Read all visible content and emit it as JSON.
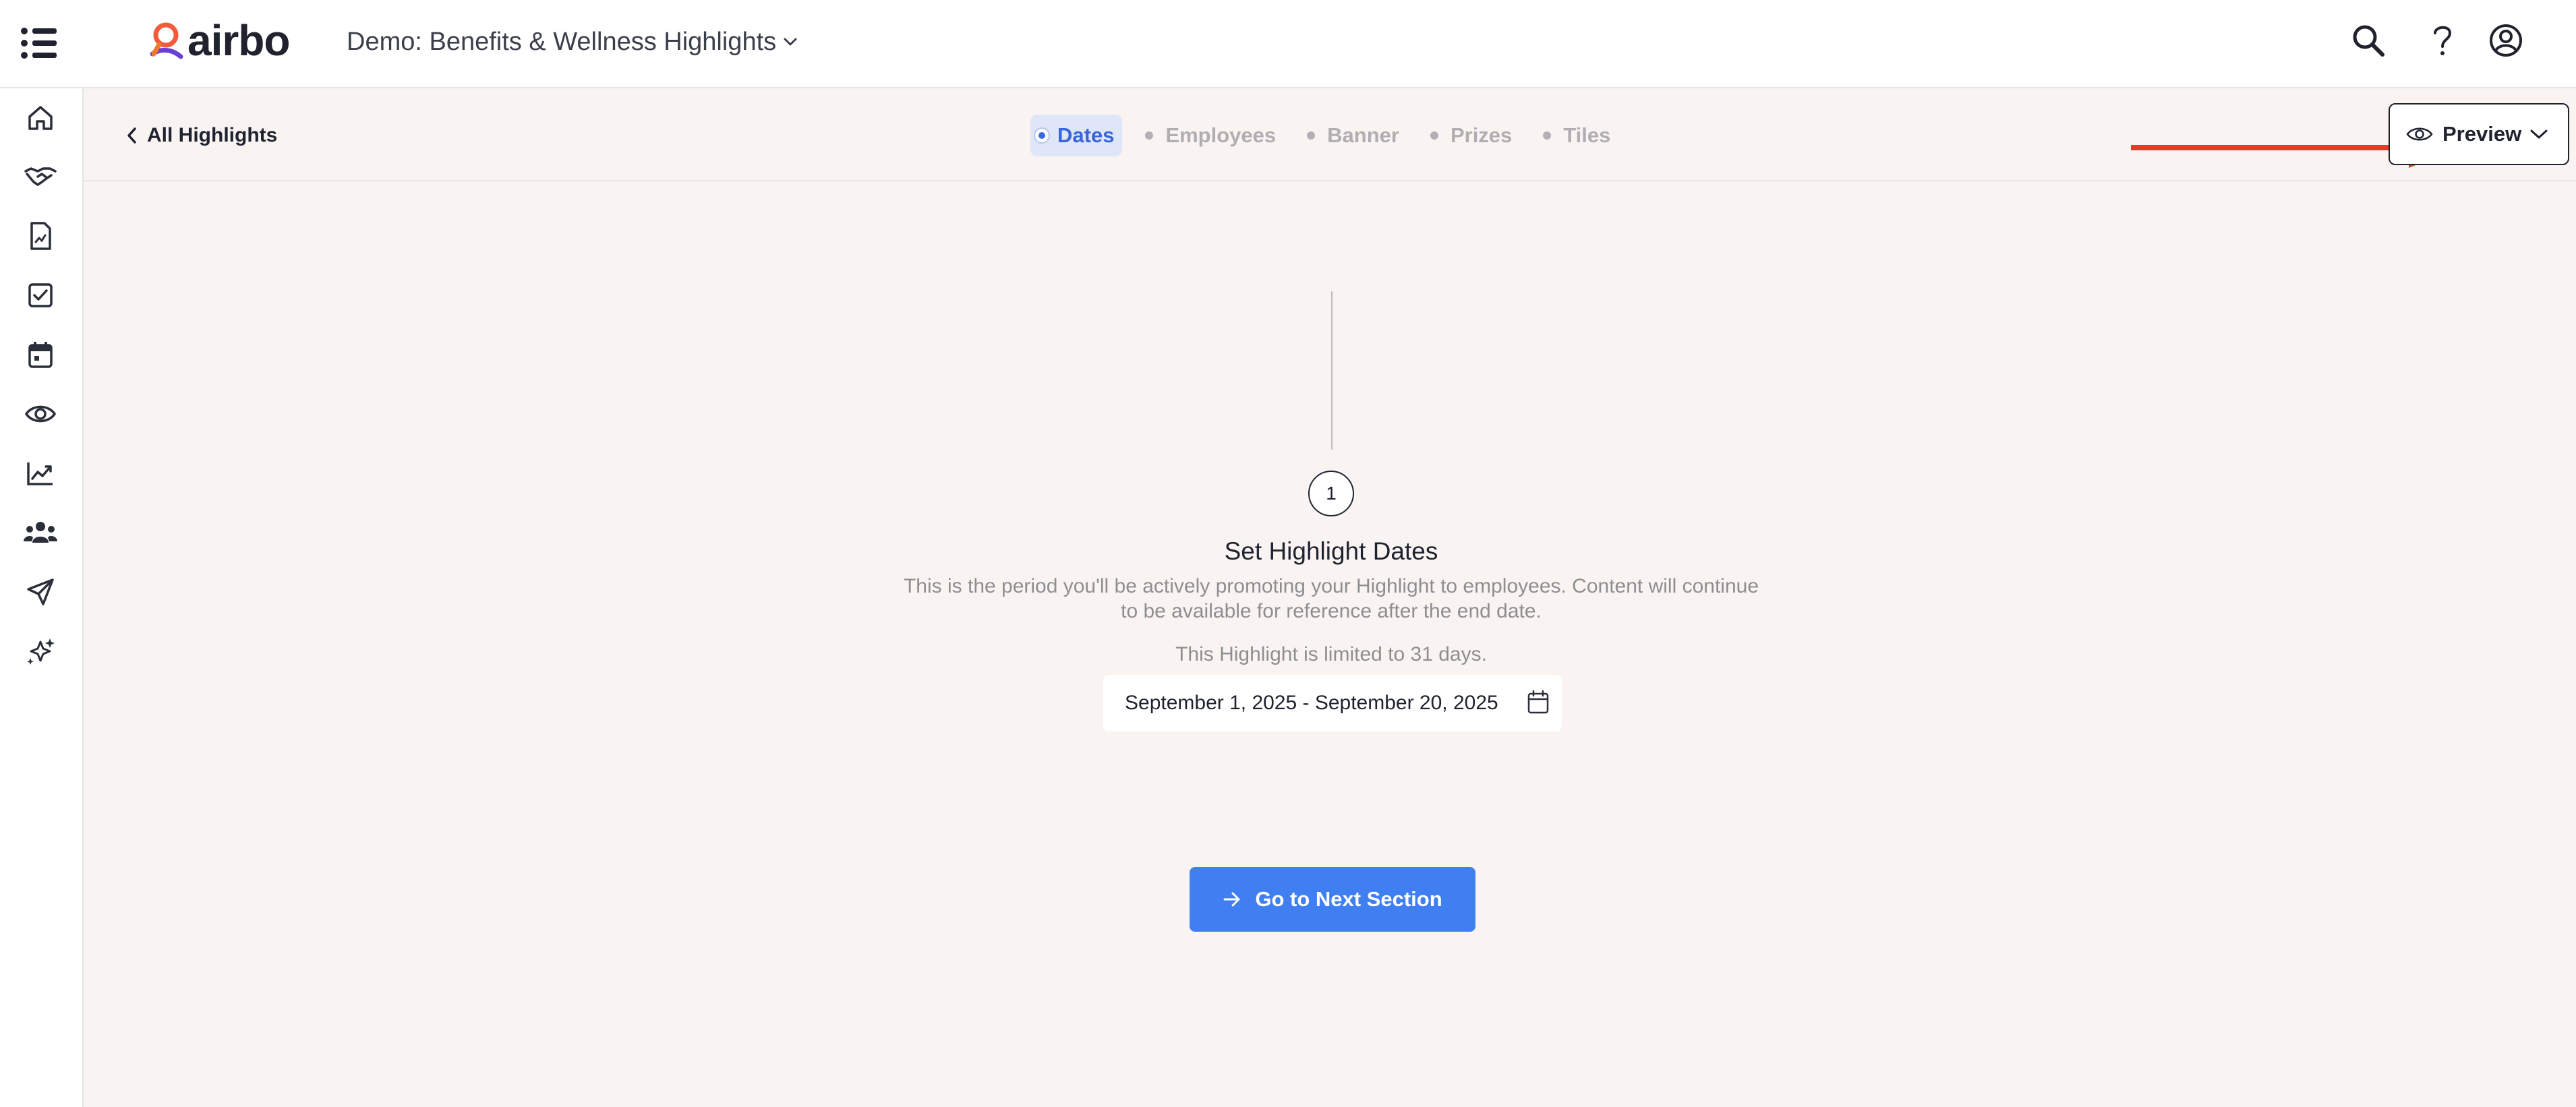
{
  "topbar": {
    "brand": "airbo",
    "workspace": "Demo: Benefits & Wellness Highlights",
    "icons": [
      "search-icon",
      "help-icon",
      "account-icon"
    ]
  },
  "sidebar": {
    "items": [
      {
        "icon": "home-icon"
      },
      {
        "icon": "handshake-icon"
      },
      {
        "icon": "document-icon"
      },
      {
        "icon": "checkbox-icon"
      },
      {
        "icon": "calendar-icon"
      },
      {
        "icon": "eye-icon"
      },
      {
        "icon": "trend-chart-icon"
      },
      {
        "icon": "people-icon"
      },
      {
        "icon": "send-icon"
      },
      {
        "icon": "sparkles-icon"
      }
    ]
  },
  "subnav": {
    "back_label": "All Highlights",
    "steps": [
      {
        "label": "Dates",
        "active": true
      },
      {
        "label": "Employees",
        "active": false
      },
      {
        "label": "Banner",
        "active": false
      },
      {
        "label": "Prizes",
        "active": false
      },
      {
        "label": "Tiles",
        "active": false
      }
    ],
    "preview_label": "Preview"
  },
  "content": {
    "step_number": "1",
    "title": "Set Highlight Dates",
    "description_line1": "This is the period you'll be actively promoting your Highlight to employees. Content will continue",
    "description_line2": "to be available for reference after the end date.",
    "limit_text": "This Highlight is limited to 31 days.",
    "date_range": "September 1, 2025 - September 20, 2025",
    "next_button_label": "Go to Next Section"
  },
  "colors": {
    "accent": "#3f7ff2",
    "active_step": "#3a64d8",
    "annotation_arrow": "#e8392a",
    "page_background": "#f9f4f2"
  }
}
